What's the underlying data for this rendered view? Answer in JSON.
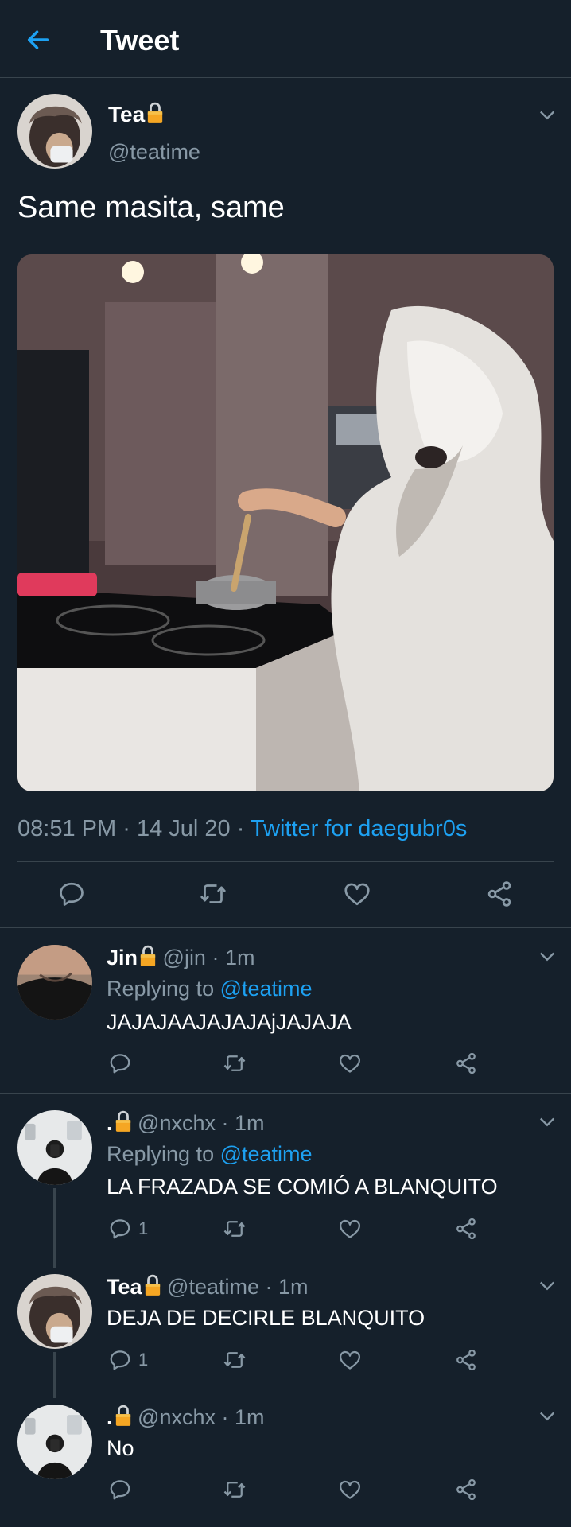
{
  "header": {
    "title": "Tweet",
    "back_icon": "arrow-left-icon"
  },
  "colors": {
    "background": "#15202b",
    "accent": "#1da1f2",
    "muted": "#8899a6",
    "divider": "#38444d",
    "lock": "#f5a623"
  },
  "main_tweet": {
    "name": "Tea",
    "handle": "@teatime",
    "text": "Same masita, same",
    "time": "08:51 PM",
    "sep1": "·",
    "date": "14 Jul 20",
    "sep2": "·",
    "source": "Twitter for daegubr0s",
    "image_alt": "Person wrapped in a duvet stirring a pot in a kitchen"
  },
  "replies": [
    {
      "name": "Jin",
      "handle": "@jin",
      "dot": "·",
      "time": "1m",
      "replying_prefix": "Replying to",
      "replying_to": "@teatime",
      "text": "JAJAJAAJAJAJAjJAJAJA",
      "reply_count": ""
    },
    {
      "name": ".",
      "handle": "@nxchx",
      "dot": "·",
      "time": "1m",
      "replying_prefix": "Replying to",
      "replying_to": "@teatime",
      "text": "LA FRAZADA SE COMIÓ A BLANQUITO",
      "reply_count": "1"
    },
    {
      "name": "Tea",
      "handle": "@teatime",
      "dot": "·",
      "time": "1m",
      "text": "DEJA DE DECIRLE BLANQUITO",
      "reply_count": "1"
    },
    {
      "name": ".",
      "handle": "@nxchx",
      "dot": "·",
      "time": "1m",
      "text": "No",
      "reply_count": ""
    }
  ]
}
